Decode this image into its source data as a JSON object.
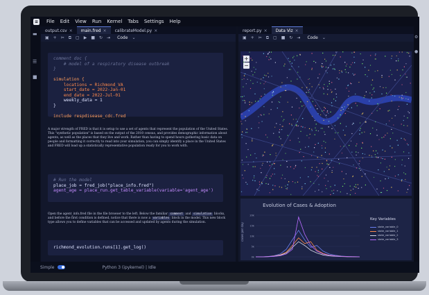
{
  "menu": [
    "File",
    "Edit",
    "View",
    "Run",
    "Kernel",
    "Tabs",
    "Settings",
    "Help"
  ],
  "left_tabs": [
    {
      "label": "output.csv",
      "active": false
    },
    {
      "label": "main.fred",
      "active": true
    },
    {
      "label": "calibrateModel.py",
      "active": false
    }
  ],
  "right_tabs": [
    {
      "label": "report.py",
      "active": false
    },
    {
      "label": "Data Viz",
      "active": true
    }
  ],
  "toolbar": {
    "cell_type": "Code"
  },
  "cells": {
    "c1": {
      "comment_open": "comment doc {",
      "comment_body": "    # model of a respiratory disease outbreak",
      "comment_close": "}",
      "sim_open": "simulation {",
      "locations": "    locations = Richmond_VA",
      "start_date": "    start_date = 2022-Jan-01",
      "end_date": "    end_date = 2022-Jul-01",
      "weekly_data": "    weekly_data = 1",
      "sim_close": "}",
      "include": "include respdisease_cdc.fred"
    },
    "c2": {
      "comment": "# Run the model",
      "line1": "place_job = fred_job(\"place_info.fred\")",
      "line2": "agent_age = place_run.get_table_variable(variable='agent_age')"
    },
    "c3": {
      "line1": "richmond_evolution.runs[1].get_log()"
    }
  },
  "prose1": "A major strength of FRED is that it is setup to use a set of agents that represent the population of the United States. This \"synthetic population\" is based on the output of the 2010 census, and provides demographic information about agents, as well as the places that they live and work. Rather than having to spend hours gathering basic data on people and formatting it correctly to read into your simulation, you can simply identify a place in the United States and FRED will load up a statistically representative population ready for you to work with.",
  "prose2": {
    "a": "Open the agent_info.fred file in the file browser to the left. Below the familiar",
    "chip1": "comment",
    "b": "and",
    "chip2": "simulation",
    "c": "blocks, and before the first condition is defined, notice that there is now a",
    "chip3": "variables",
    "d": "block in the model. This new block type allows you to define variables that can be accessed and updated by agents during the simulation."
  },
  "statusbar": {
    "mode": "Simple",
    "kernel": "Python 3 (ipykernel) | Idle"
  },
  "map": {
    "zoom_in": "+",
    "zoom_out": "−"
  },
  "chart_data": {
    "type": "line",
    "title": "Evolution of Cases & Adoption",
    "legend_title": "Key Variables",
    "legend_position": "right",
    "ylabel": "cases per day",
    "ytick_labels": [
      "20k",
      "15k",
      "10k",
      "5k",
      "0k"
    ],
    "ylim": [
      0,
      22000
    ],
    "series": [
      {
        "name": "state_variable_0",
        "color": "#6a7ff0",
        "values": [
          0,
          0,
          200,
          600,
          1500,
          4000,
          9000,
          14000,
          9000,
          5000,
          6000,
          3000,
          1500,
          800,
          400,
          200,
          100,
          50
        ]
      },
      {
        "name": "state_variable_1",
        "color": "#ff8a4c",
        "values": [
          0,
          0,
          150,
          400,
          1000,
          2500,
          6000,
          10000,
          7000,
          8000,
          3500,
          1800,
          900,
          500,
          250,
          120,
          60,
          30
        ]
      },
      {
        "name": "state_variable_2",
        "color": "#d8d8e8",
        "values": [
          0,
          0,
          100,
          300,
          800,
          2000,
          5000,
          8000,
          6000,
          3500,
          2000,
          1000,
          500,
          300,
          150,
          80,
          40,
          20
        ]
      },
      {
        "name": "state_variable_3",
        "color": "#b86bff",
        "values": [
          0,
          0,
          80,
          250,
          600,
          1500,
          4000,
          21000,
          12000,
          6000,
          3000,
          1500,
          800,
          400,
          200,
          100,
          50,
          20
        ]
      }
    ]
  }
}
